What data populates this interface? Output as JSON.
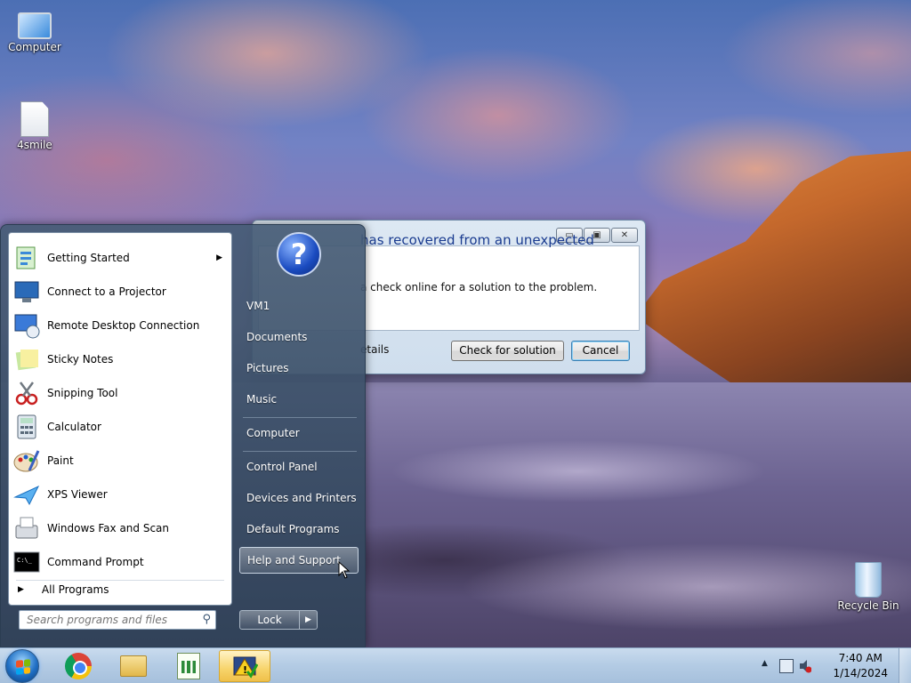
{
  "desktop": {
    "icons": [
      {
        "label": "Computer",
        "icon": "computer-icon"
      },
      {
        "label": "4smile",
        "icon": "text-document-icon"
      },
      {
        "label": "Recycle Bin",
        "icon": "recycle-bin-icon"
      }
    ]
  },
  "dialog": {
    "heading": "has recovered from an unexpected",
    "body": "a check online for a solution to the problem.",
    "details": "etails",
    "check_button": "Check for solution",
    "cancel_button": "Cancel",
    "min_glyph": "▭",
    "max_glyph": "▣",
    "close_glyph": "✕"
  },
  "start_menu": {
    "programs": [
      {
        "label": "Getting Started",
        "icon": "getting-started-icon",
        "has_submenu": true
      },
      {
        "label": "Connect to a Projector",
        "icon": "projector-icon"
      },
      {
        "label": "Remote Desktop Connection",
        "icon": "remote-desktop-icon"
      },
      {
        "label": "Sticky Notes",
        "icon": "sticky-notes-icon"
      },
      {
        "label": "Snipping Tool",
        "icon": "snipping-tool-icon"
      },
      {
        "label": "Calculator",
        "icon": "calculator-icon"
      },
      {
        "label": "Paint",
        "icon": "paint-icon"
      },
      {
        "label": "XPS Viewer",
        "icon": "xps-viewer-icon"
      },
      {
        "label": "Windows Fax and Scan",
        "icon": "fax-scan-icon"
      },
      {
        "label": "Command Prompt",
        "icon": "command-prompt-icon"
      }
    ],
    "all_programs": "All Programs",
    "search_placeholder": "Search programs and files",
    "right_links": [
      {
        "label": "VM1"
      },
      {
        "label": "Documents"
      },
      {
        "label": "Pictures"
      },
      {
        "label": "Music"
      },
      {
        "label": "Computer"
      },
      {
        "label": "Control Panel"
      },
      {
        "label": "Devices and Printers"
      },
      {
        "label": "Default Programs"
      },
      {
        "label": "Help and Support",
        "hovered": true
      }
    ],
    "help_glyph": "?",
    "lock_label": "Lock"
  },
  "taskbar": {
    "pinned": [
      {
        "icon": "start-orb-icon"
      },
      {
        "icon": "chrome-icon"
      },
      {
        "icon": "file-explorer-icon"
      },
      {
        "icon": "chart-app-icon"
      },
      {
        "icon": "action-center-warning-icon",
        "active": true
      }
    ],
    "clock_time": "7:40 AM",
    "clock_date": "1/14/2024"
  }
}
